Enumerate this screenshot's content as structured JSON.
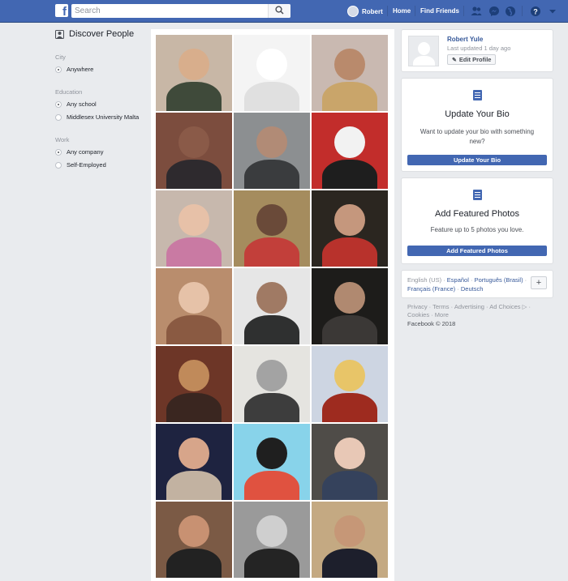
{
  "header": {
    "search_placeholder": "Search",
    "user_name": "Robert",
    "home_label": "Home",
    "find_friends_label": "Find Friends"
  },
  "sidebar": {
    "title": "Discover People",
    "filters": [
      {
        "label": "City",
        "options": [
          {
            "label": "Anywhere",
            "selected": true
          }
        ]
      },
      {
        "label": "Education",
        "options": [
          {
            "label": "Any school",
            "selected": true
          },
          {
            "label": "Middlesex University Malta",
            "selected": false
          }
        ]
      },
      {
        "label": "Work",
        "options": [
          {
            "label": "Any company",
            "selected": true
          },
          {
            "label": "Self-Employed",
            "selected": false
          }
        ]
      }
    ]
  },
  "grid": {
    "tiles": [
      {
        "bg": "#c8b7a6",
        "head": "#d8ae8c",
        "body": "#3f4a3a"
      },
      {
        "bg": "#f4f4f4",
        "head": "#ffffff",
        "body": "#e0e0e0"
      },
      {
        "bg": "#c9b9b1",
        "head": "#b98a6c",
        "body": "#c9a56a"
      },
      {
        "bg": "#7c4d3e",
        "head": "#8a5a48",
        "body": "#2e2a2e"
      },
      {
        "bg": "#8c8f91",
        "head": "#b18b76",
        "body": "#3a3c3e"
      },
      {
        "bg": "#c22d2b",
        "head": "#f2f2f2",
        "body": "#1e1e1e"
      },
      {
        "bg": "#c7b8ad",
        "head": "#e7c1a8",
        "body": "#c97aa3"
      },
      {
        "bg": "#a58c5e",
        "head": "#6a4a39",
        "body": "#c23f3a"
      },
      {
        "bg": "#2b2620",
        "head": "#c5977d",
        "body": "#b8322c"
      },
      {
        "bg": "#b98d6d",
        "head": "#e6c2a8",
        "body": "#8a5a42"
      },
      {
        "bg": "#e6e6e6",
        "head": "#a07a64",
        "body": "#2f3030"
      },
      {
        "bg": "#1d1c1a",
        "head": "#b08970",
        "body": "#3b3836"
      },
      {
        "bg": "#6d3627",
        "head": "#c08a5a",
        "body": "#3a2620"
      },
      {
        "bg": "#e5e4e0",
        "head": "#a3a3a3",
        "body": "#3d3d3d"
      },
      {
        "bg": "#cdd5e2",
        "head": "#e8c568",
        "body": "#9e2b1f"
      },
      {
        "bg": "#1e2340",
        "head": "#d7a58a",
        "body": "#c2b2a1"
      },
      {
        "bg": "#88d3ea",
        "head": "#1f1f1f",
        "body": "#e05240"
      },
      {
        "bg": "#4f4c48",
        "head": "#e8c8b6",
        "body": "#35425c"
      },
      {
        "bg": "#7b5a45",
        "head": "#c89172",
        "body": "#222222"
      },
      {
        "bg": "#9a9a9a",
        "head": "#cfcfcf",
        "body": "#242424"
      },
      {
        "bg": "#c4a982",
        "head": "#c69777",
        "body": "#1d1f2c"
      }
    ]
  },
  "profile": {
    "name": "Robert Yule",
    "updated": "Last updated 1 day ago",
    "edit_label": "Edit Profile"
  },
  "bio_card": {
    "title": "Update Your Bio",
    "text": "Want to update your bio with something new?",
    "button": "Update Your Bio"
  },
  "photos_card": {
    "title": "Add Featured Photos",
    "text": "Feature up to 5 photos you love.",
    "button": "Add Featured Photos"
  },
  "languages": {
    "current": "English (US)",
    "links": [
      "Español",
      "Português (Brasil)",
      "Français (France)",
      "Deutsch"
    ],
    "add_label": "+"
  },
  "footer": {
    "links": [
      "Privacy",
      "Terms",
      "Advertising",
      "Ad Choices",
      "Cookies",
      "More"
    ],
    "copyright": "Facebook © 2018"
  }
}
